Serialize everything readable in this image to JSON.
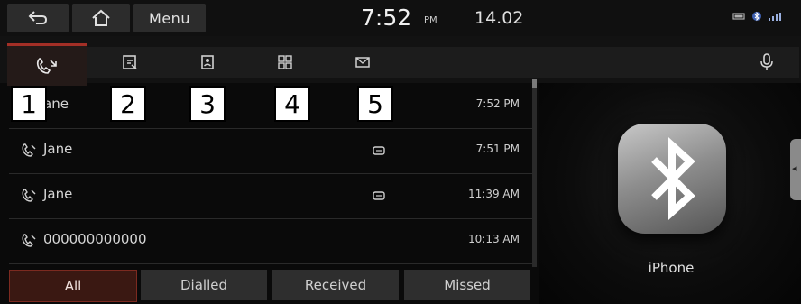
{
  "header": {
    "menu_label": "Menu",
    "clock": "7:52",
    "ampm": "PM",
    "date": "14.02"
  },
  "tabs": [
    {
      "icon": "recent-calls-icon",
      "active": true
    },
    {
      "icon": "favourites-icon"
    },
    {
      "icon": "contacts-icon"
    },
    {
      "icon": "keypad-icon"
    },
    {
      "icon": "messages-icon"
    }
  ],
  "callouts": [
    "1",
    "2",
    "3",
    "4",
    "5"
  ],
  "call_list": [
    {
      "name": "ane",
      "time": "7:52 PM",
      "has_message": false
    },
    {
      "name": "Jane",
      "time": "7:51 PM",
      "has_message": true
    },
    {
      "name": "Jane",
      "time": "11:39 AM",
      "has_message": true
    },
    {
      "name": "000000000000",
      "time": "10:13 AM",
      "has_message": false
    }
  ],
  "filters": {
    "all": "All",
    "dialled": "Dialled",
    "received": "Received",
    "missed": "Missed",
    "selected": "All"
  },
  "device": {
    "name": "iPhone"
  },
  "colors": {
    "accent": "#a32f26",
    "background": "#0a0a0a",
    "button": "#2e2e2e"
  }
}
